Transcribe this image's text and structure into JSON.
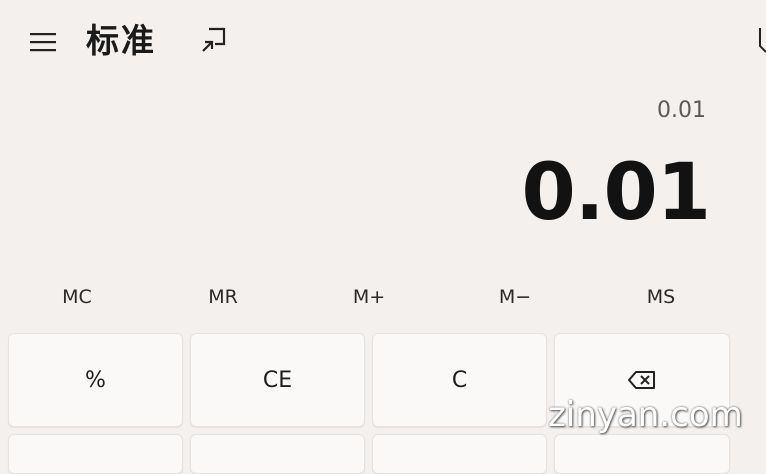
{
  "header": {
    "title": "标准",
    "menu_icon": "hamburger-menu-icon",
    "keep_on_top_icon": "keep-on-top-icon"
  },
  "display": {
    "expression": "0.01",
    "result": "0.01"
  },
  "memory": [
    "MC",
    "MR",
    "M+",
    "M−",
    "MS"
  ],
  "keypad": {
    "row1": [
      {
        "label": "%"
      },
      {
        "label": "CE"
      },
      {
        "label": "C"
      },
      {
        "icon": "backspace-icon"
      }
    ]
  },
  "watermark": "zinyan.com"
}
